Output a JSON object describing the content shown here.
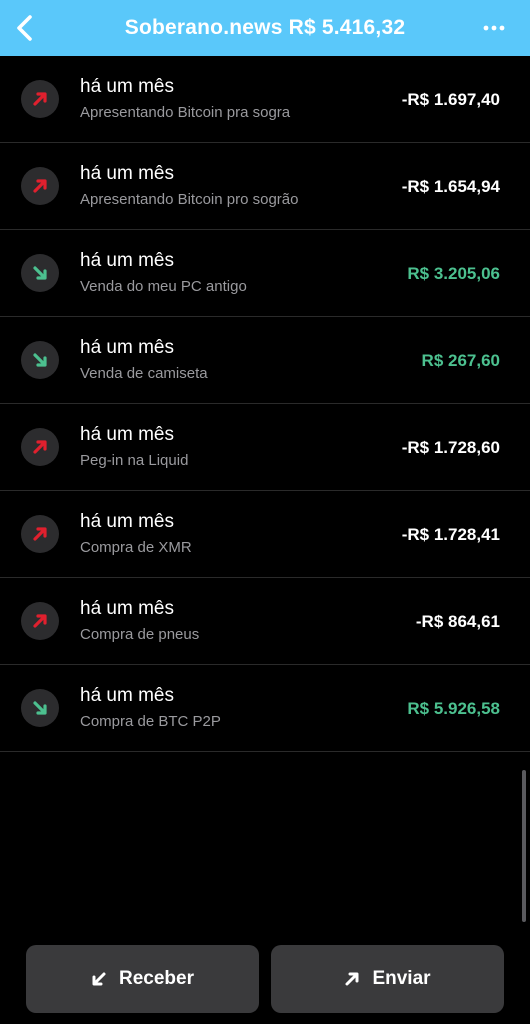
{
  "header": {
    "title": "Soberano.news R$ 5.416,32",
    "back_icon": "chevron-left-icon",
    "more_icon": "more-horizontal-icon",
    "background_color": "#5ac8fa"
  },
  "transactions": [
    {
      "time": "há um mês",
      "description": "Apresentando Bitcoin pra sogra",
      "amount": "-R$ 1.697,40",
      "direction": "outgoing"
    },
    {
      "time": "há um mês",
      "description": "Apresentando Bitcoin pro sogrão",
      "amount": "-R$ 1.654,94",
      "direction": "outgoing"
    },
    {
      "time": "há um mês",
      "description": "Venda do meu PC antigo",
      "amount": "R$ 3.205,06",
      "direction": "incoming"
    },
    {
      "time": "há um mês",
      "description": "Venda de camiseta",
      "amount": "R$ 267,60",
      "direction": "incoming"
    },
    {
      "time": "há um mês",
      "description": "Peg-in na Liquid",
      "amount": "-R$ 1.728,60",
      "direction": "outgoing"
    },
    {
      "time": "há um mês",
      "description": "Compra de XMR",
      "amount": "-R$ 1.728,41",
      "direction": "outgoing"
    },
    {
      "time": "há um mês",
      "description": "Compra de pneus",
      "amount": "-R$ 864,61",
      "direction": "outgoing"
    },
    {
      "time": "há um mês",
      "description": "Compra de BTC P2P",
      "amount": "R$ 5.926,58",
      "direction": "incoming"
    }
  ],
  "colors": {
    "outgoing_arrow": "#e0202e",
    "incoming_arrow": "#4cc08f",
    "incoming_amount": "#4cc08f"
  },
  "actions": {
    "receive_label": "Receber",
    "send_label": "Enviar",
    "receive_icon": "arrow-down-left-icon",
    "send_icon": "arrow-up-right-icon"
  }
}
